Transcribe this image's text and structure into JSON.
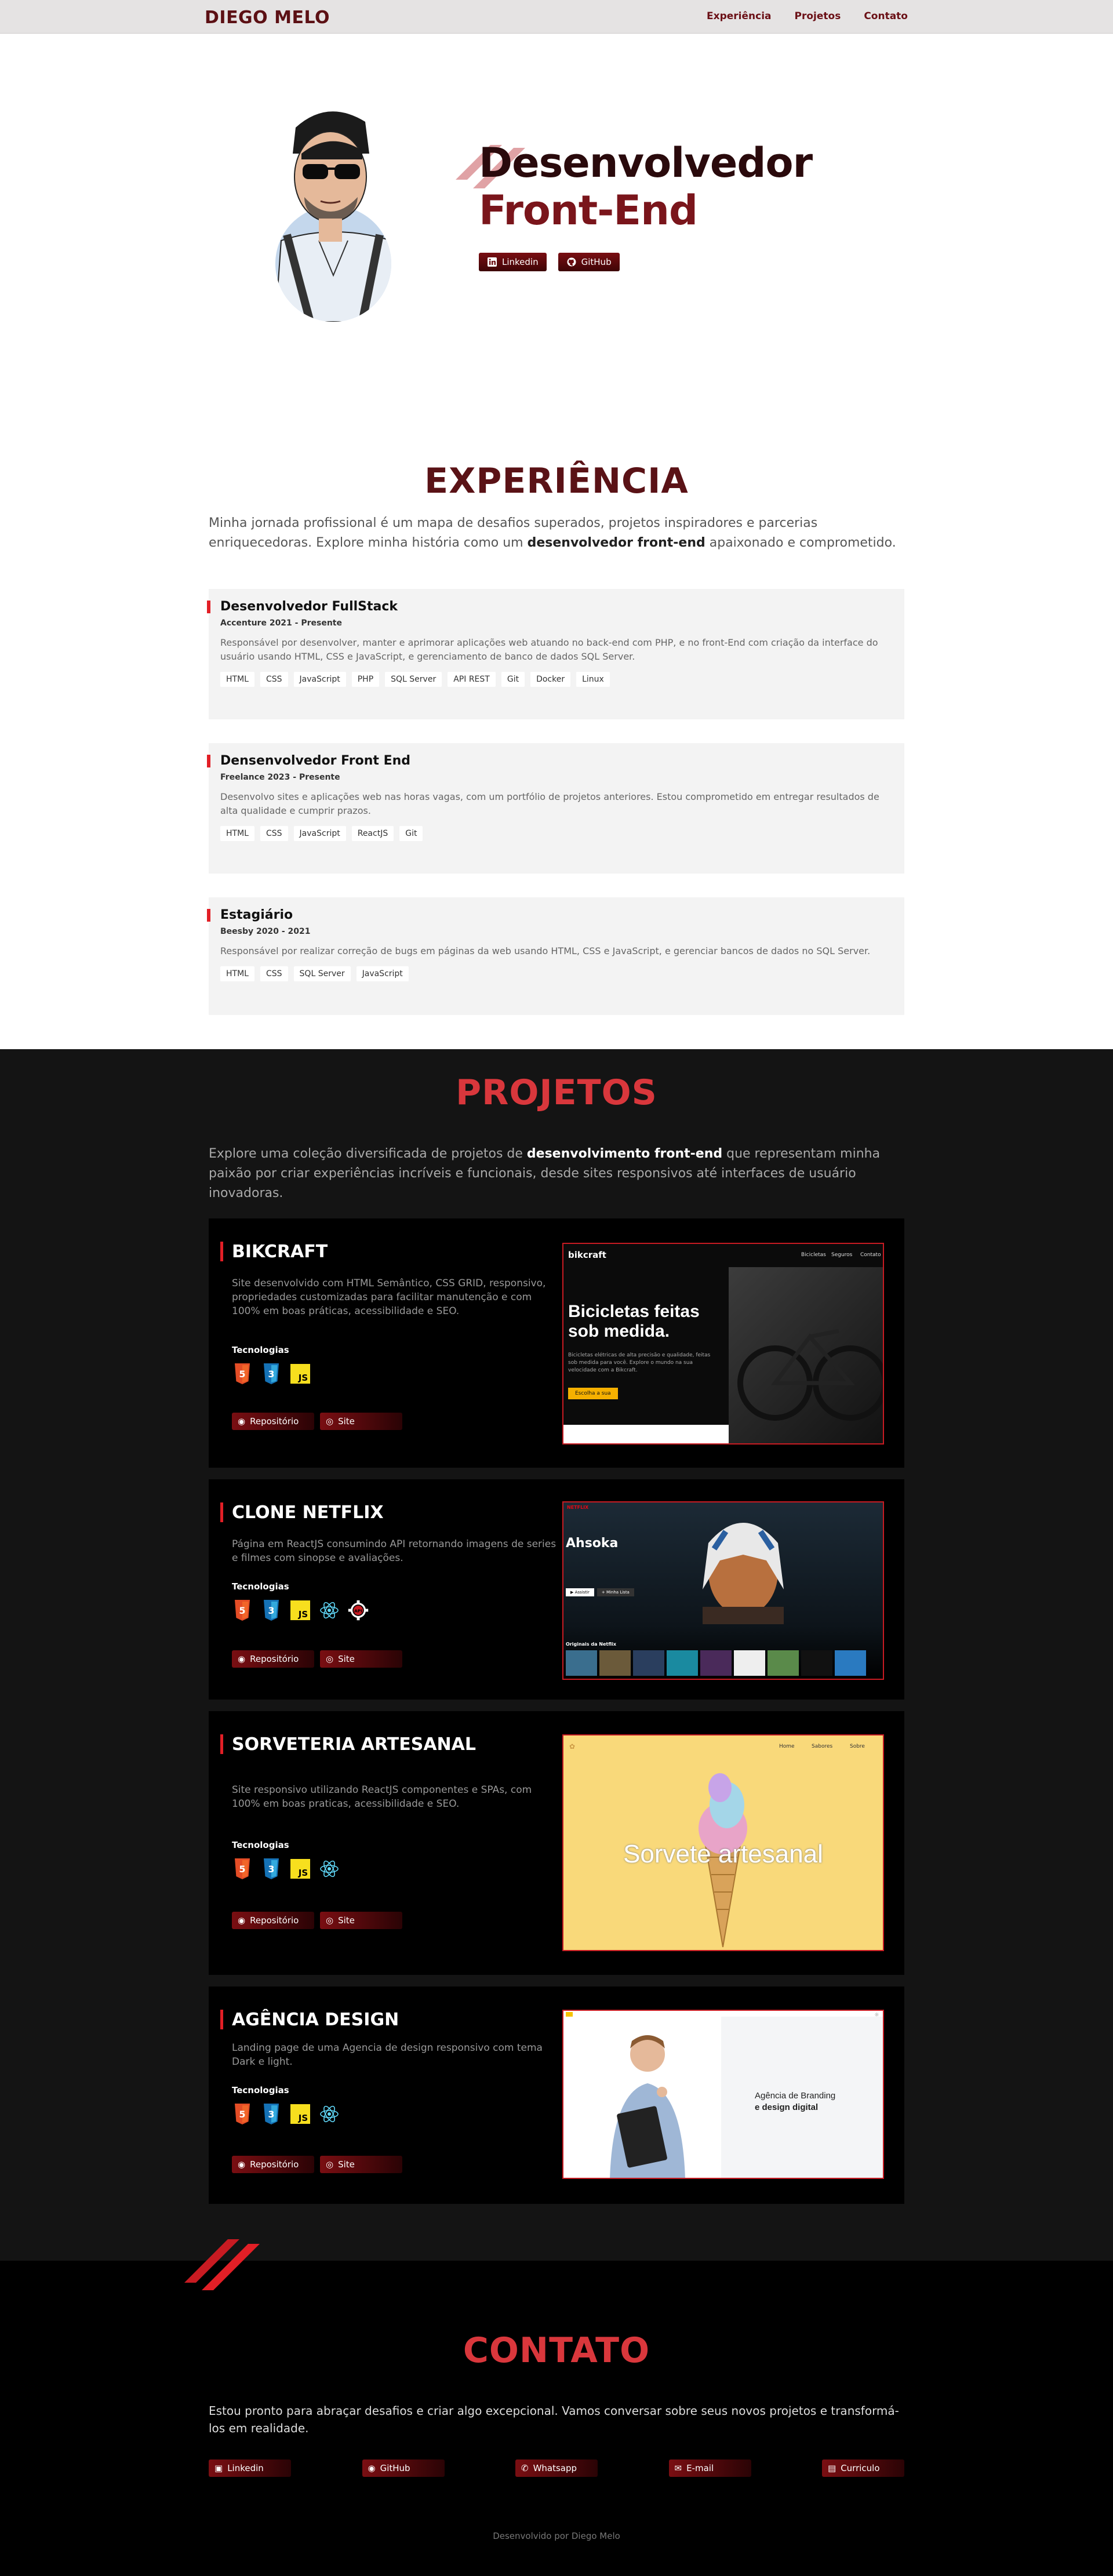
{
  "header": {
    "brand": "DIEGO MELO",
    "nav": [
      "Experiência",
      "Projetos",
      "Contato"
    ]
  },
  "hero": {
    "title_line1": "Desenvolvedor",
    "title_line2": "Front-End",
    "buttons": [
      "Linkedin",
      "GitHub"
    ]
  },
  "experience": {
    "title": "EXPERIÊNCIA",
    "intro_before": "Minha jornada profissional é um mapa de desafios superados, projetos inspiradores e parcerias enriquecedoras. Explore minha história como um ",
    "intro_bold": "desenvolvedor front-end",
    "intro_after": " apaixonado e comprometido.",
    "jobs": [
      {
        "role": "Desenvolvedor FullStack",
        "meta": "Accenture 2021 - Presente",
        "desc": "Responsável por desenvolver, manter e aprimorar aplicações web atuando no back-end com PHP, e no front-End com criação da interface do usuário usando HTML, CSS e JavaScript, e gerenciamento de banco de dados SQL Server.",
        "tags": [
          "HTML",
          "CSS",
          "JavaScript",
          "PHP",
          "SQL Server",
          "API REST",
          "Git",
          "Docker",
          "Linux"
        ]
      },
      {
        "role": "Densenvolvedor Front End",
        "meta": "Freelance 2023 - Presente",
        "desc": "Desenvolvo sites e aplicações web nas horas vagas, com um portfólio de projetos anteriores. Estou comprometido em entregar resultados de alta qualidade e cumprir prazos.",
        "tags": [
          "HTML",
          "CSS",
          "JavaScript",
          "ReactJS",
          "Git"
        ]
      },
      {
        "role": "Estagiário",
        "meta": "Beesby 2020 - 2021",
        "desc": "Responsável por realizar correção de bugs em páginas da web usando HTML, CSS e JavaScript, e gerenciar bancos de dados no SQL Server.",
        "tags": [
          "HTML",
          "CSS",
          "SQL Server",
          "JavaScript"
        ]
      }
    ]
  },
  "projects": {
    "title": "PROJETOS",
    "intro_before": "Explore uma coleção diversificada de projetos de ",
    "intro_bold": "desenvolvimento front-end",
    "intro_after": " que representam minha paixão por criar experiências incríveis e funcionais, desde sites responsivos até interfaces de usuário inovadoras.",
    "tech_label": "Tecnologias",
    "repo_label": "Repositório",
    "site_label": "Site",
    "items": [
      {
        "name": "BIKCRAFT",
        "desc": "Site desenvolvido com HTML Semântico, CSS GRID, responsivo, propriedades customizadas para facilitar manutenção e com 100% em boas práticas, acessibilidade e SEO.",
        "techs": [
          "html5-icon",
          "css3-icon",
          "js-icon"
        ],
        "shot": {
          "logo": "bikcraft",
          "nav": [
            "Bicicletas",
            "Seguros",
            "Contato"
          ],
          "headline": "Bicicletas feitas sob medida.",
          "text": "Bicicletas elétricas de alta precisão e qualidade, feitas sob medida para você. Explore o mundo na sua velocidade com a Bikcraft.",
          "cta": "Escolha a sua"
        }
      },
      {
        "name": "CLONE NETFLIX",
        "desc": "Página em ReactJS consumindo API retornando imagens de series e filmes com sinopse e avaliações.",
        "techs": [
          "html5-icon",
          "css3-icon",
          "js-icon",
          "react-icon",
          "api-icon"
        ],
        "shot": {
          "logo": "NETFLIX",
          "headline": "Ahsoka",
          "row_title": "Originais da Netflix",
          "btn1": "▶ Assistir",
          "btn2": "+ Minha Lista"
        }
      },
      {
        "name": "SORVETERIA ARTESANAL",
        "desc": "Site responsivo utilizando ReactJS componentes e SPAs, com 100% em boas praticas, acessibilidade e SEO.",
        "techs": [
          "html5-icon",
          "css3-icon",
          "js-icon",
          "react-icon"
        ],
        "shot": {
          "nav": [
            "Home",
            "Sabores",
            "Sobre"
          ],
          "headline": "Sorvete artesanal"
        }
      },
      {
        "name": "AGÊNCIA DESIGN",
        "desc": "Landing page de uma Agencia de design responsivo com tema Dark e light.",
        "techs": [
          "html5-icon",
          "css3-icon",
          "js-icon",
          "react-icon"
        ],
        "shot": {
          "line1": "Agência de Branding",
          "line2": "e design digital"
        }
      }
    ]
  },
  "contact": {
    "title": "CONTATO",
    "intro": "Estou pronto para abraçar desafios e criar algo excepcional. Vamos conversar sobre seus novos projetos e transformá-los em realidade.",
    "buttons": [
      "Linkedin",
      "GitHub",
      "Whatsapp",
      "E-mail",
      "Curriculo"
    ]
  },
  "footer": "Desenvolvido por Diego Melo",
  "colors": {
    "accent": "#e21f26",
    "dark_red": "#5a1216",
    "project_bg": "#141414"
  }
}
